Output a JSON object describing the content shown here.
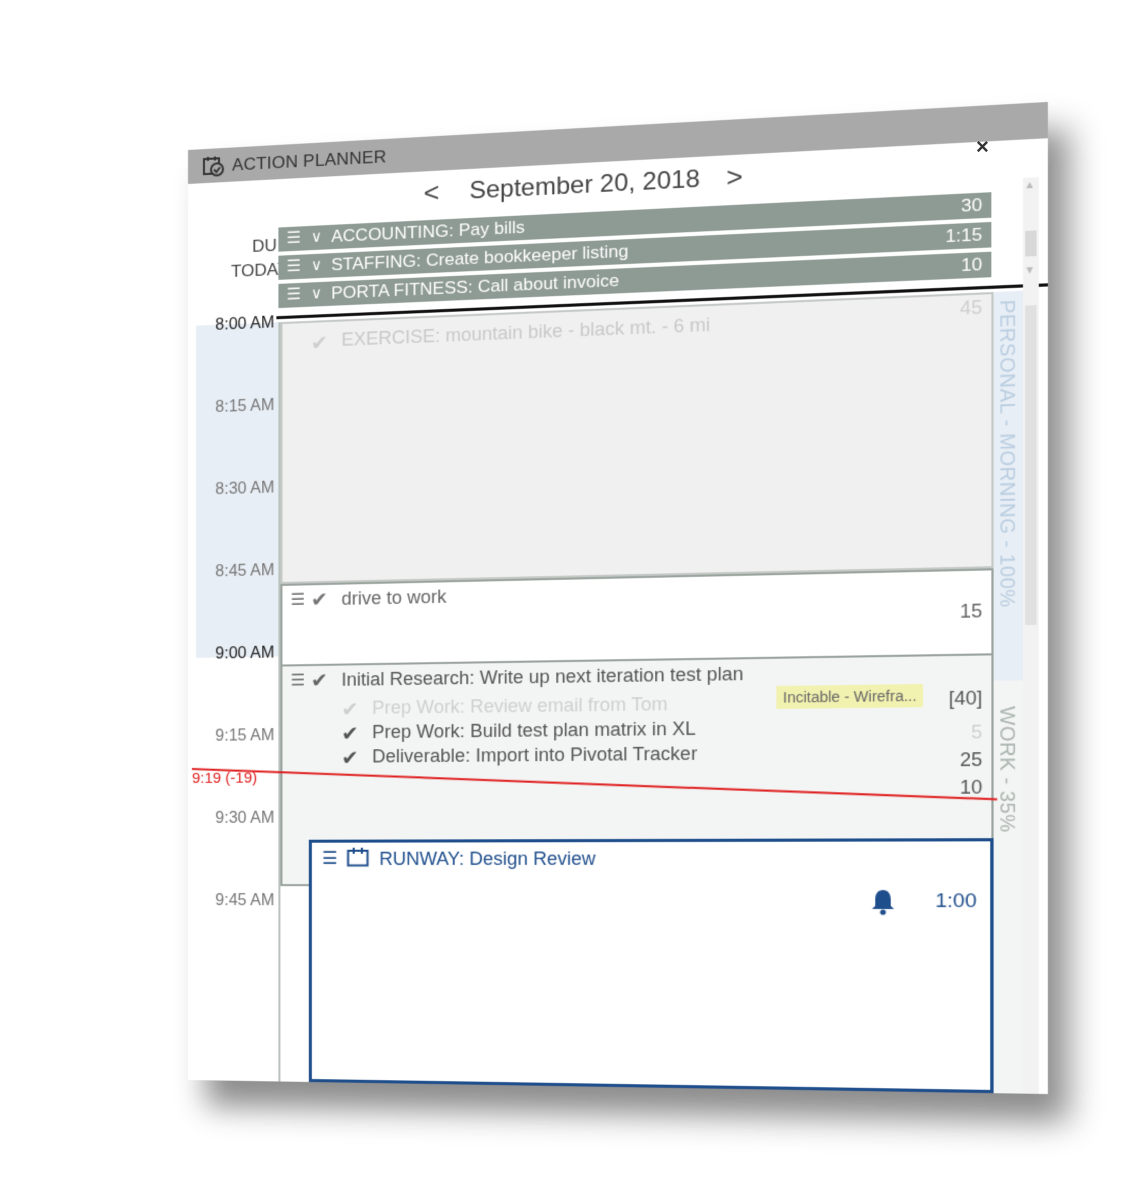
{
  "window": {
    "title": "ACTION PLANNER",
    "close": "×"
  },
  "date_nav": {
    "prev": "<",
    "date": "September 20, 2018",
    "next": ">"
  },
  "due_today": {
    "label_line1": "DUE",
    "label_line2": "TODAY",
    "items": [
      {
        "text": "ACCOUNTING: Pay bills",
        "duration": "30"
      },
      {
        "text": "STAFFING: Create bookkeeper listing",
        "duration": "1:15"
      },
      {
        "text": "PORTA FITNESS: Call about invoice",
        "duration": "10"
      }
    ]
  },
  "times": [
    "8:00 AM",
    "8:15 AM",
    "8:30 AM",
    "8:45 AM",
    "9:00 AM",
    "9:15 AM",
    "9:30 AM",
    "9:45 AM"
  ],
  "now_marker": "9:19 (-19)",
  "blocks": {
    "exercise": {
      "text": "EXERCISE: mountain bike - black mt. - 6 mi",
      "duration": "45"
    },
    "drive": {
      "text": "drive to work",
      "duration": "15"
    },
    "research": {
      "text": "Initial Research: Write up next iteration test plan",
      "tag": "Incitable - Wirefra...",
      "total": "[40]",
      "subtasks": [
        {
          "text": "Prep Work: Review email from Tom",
          "duration": "5"
        },
        {
          "text": "Prep Work: Build test plan matrix in XL",
          "duration": "25"
        },
        {
          "text": "Deliverable: Import into Pivotal Tracker",
          "duration": "10"
        }
      ]
    },
    "runway": {
      "text": "RUNWAY: Design Review",
      "duration": "1:00"
    }
  },
  "side_labels": {
    "personal": "PERSONAL - MORNING - 100%",
    "work": "WORK - 35%"
  },
  "colors": {
    "due_bar": "#8e9a94",
    "now_line": "#e02020",
    "runway": "#1f4e8c",
    "titlebar": "#a9a9a9"
  },
  "icons": {
    "app": "calendar-check-icon",
    "menu": "hamburger-icon",
    "expand": "chevron-down-icon",
    "done": "check-circle-icon",
    "event": "calendar-icon",
    "alarm": "bell-icon"
  }
}
